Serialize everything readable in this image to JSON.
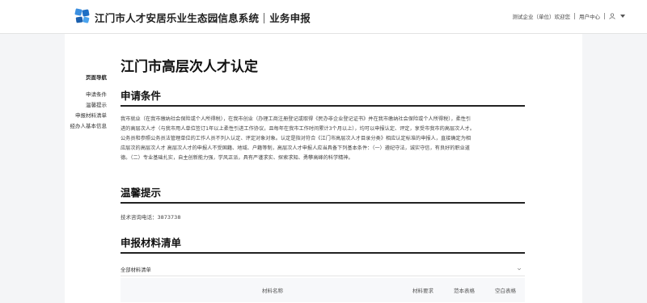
{
  "header": {
    "brand": "江门市人才安居乐业生态园信息系统",
    "module": "业务申报",
    "company": "测试企业（单位）欢迎您",
    "user_center": "用户中心",
    "user_initial": "A"
  },
  "page": {
    "title": "江门市高层次人才认定"
  },
  "side_nav": {
    "title": "页面导航",
    "items": [
      {
        "label": "申请条件"
      },
      {
        "label": "温馨提示"
      },
      {
        "label": "申报材料清单"
      },
      {
        "label": "经办人基本信息"
      }
    ]
  },
  "sections": {
    "conditions": {
      "title": "申请条件",
      "lines": [
        "我市就业（在我市缴纳社会保险或个人所得税），在我市创业（办理工商注册登记或取得《民办非企业登记证书》并在我市缴纳社会保险或个人所得税），柔性引",
        "进的高层次人才（与我市用人单位签订1年以上柔性引进工作协议，且每年在我市工作时间累计3个月以上），均可以申报认定、评定，享受市我市的高层次人才。",
        "公务员和参照公务员法管理单位的工作人员不列入认定、评定对象对象。认定是指对符合《江门市高层次人才目录分类》相应认定标准的申报人，直接确定为相",
        "应层次的高层次人才 高层次人才的申报人不受国籍、地域、户籍等制，高层次人才申报人应当具备下列基本条件：（一）遵纪守法，诚实守信，有良好的职业道",
        "德。（二）专业基础扎实，自主创新能力强，学风正派，具有严谨求实、探索求知、勇攀高峰的科学精神。"
      ]
    },
    "tips": {
      "title": "温馨提示",
      "contact": "技术咨询电话：3873738"
    },
    "materials": {
      "title": "申报材料清单",
      "all_label": "全部材料清单",
      "columns": [
        "材料名称",
        "材料要求",
        "范本表格",
        "空白表格"
      ]
    }
  },
  "colors": {
    "logo_blue": "#1e7fd6",
    "rule": "#222222",
    "background": "#f4f5f7"
  }
}
